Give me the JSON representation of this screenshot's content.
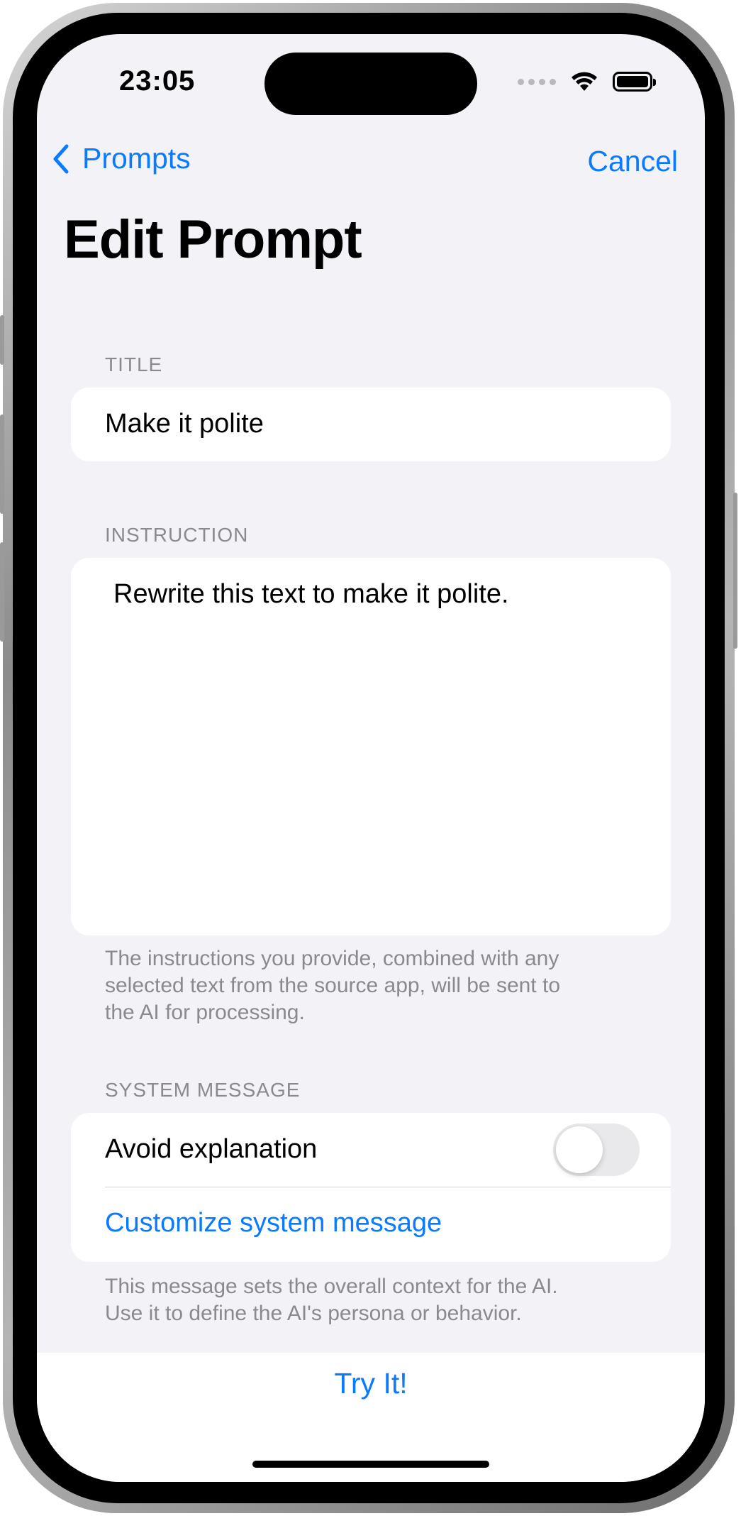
{
  "status_bar": {
    "time": "23:05"
  },
  "nav": {
    "back_label": "Prompts",
    "cancel_label": "Cancel",
    "title": "Edit Prompt"
  },
  "title_section": {
    "label": "TITLE",
    "value": "Make it polite"
  },
  "instruction_section": {
    "label": "INSTRUCTION",
    "value": "Rewrite this text to make it polite.",
    "footer_lines": [
      "The instructions you provide, combined with any",
      "selected text from the source app, will be sent to",
      "the AI for processing."
    ]
  },
  "system_section": {
    "label": "SYSTEM MESSAGE",
    "avoid_label": "Avoid explanation",
    "avoid_on": false,
    "customize_label": "Customize system message",
    "footer_lines": [
      "This message sets the overall context for the AI.",
      "Use it to define the AI's persona or behavior."
    ]
  },
  "bottom": {
    "try_label": "Try It!"
  },
  "colors": {
    "accent": "#0a7aff",
    "background": "#f2f2f7",
    "secondary_text": "#8a8a8e"
  }
}
